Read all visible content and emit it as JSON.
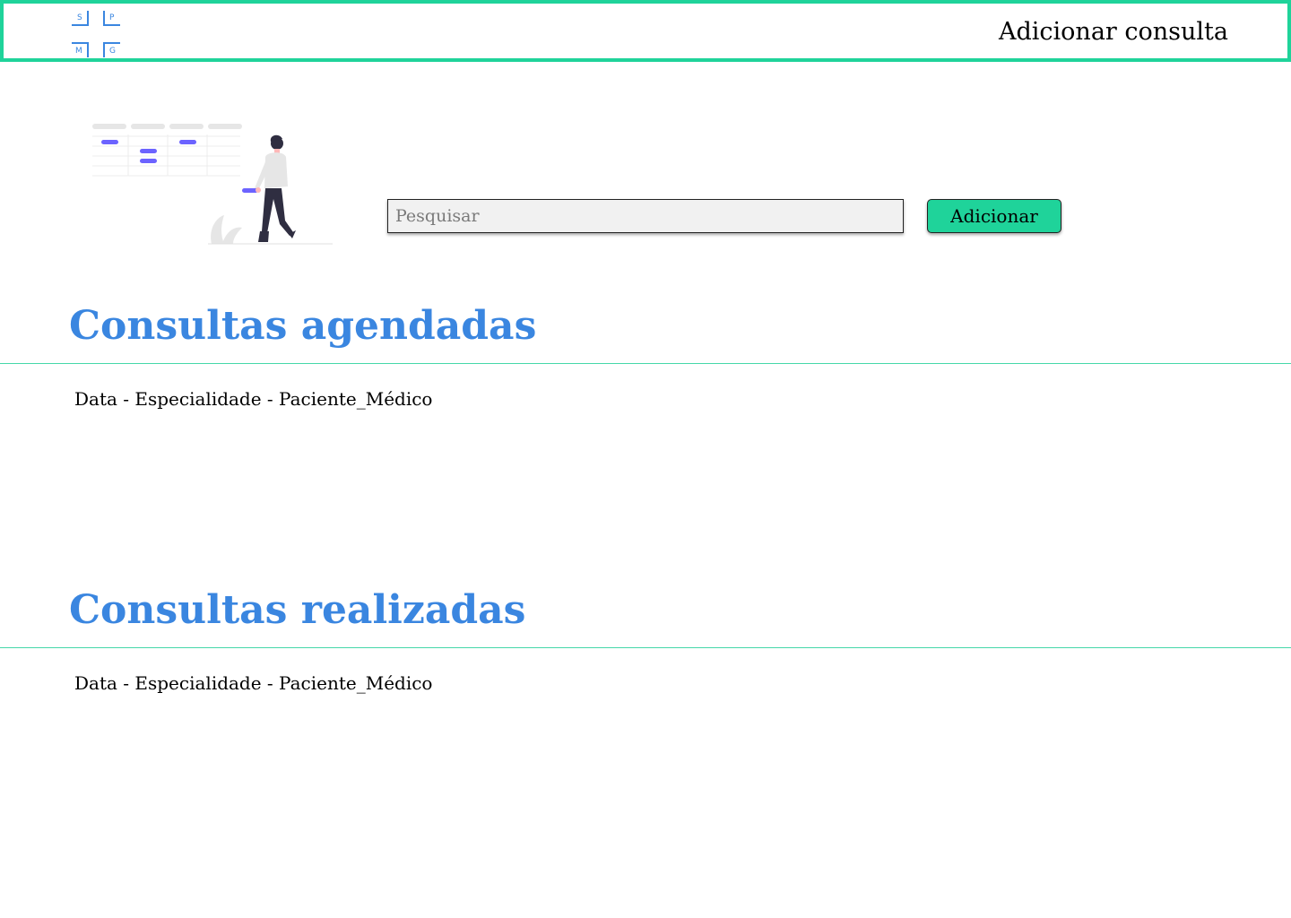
{
  "header": {
    "logo_letters": [
      "S",
      "P",
      "M",
      "G"
    ],
    "nav_link": "Adicionar consulta",
    "border_color": "#1fd39a"
  },
  "search": {
    "placeholder": "Pesquisar",
    "value": ""
  },
  "actions": {
    "add_label": "Adicionar"
  },
  "sections": {
    "scheduled": {
      "title": "Consultas agendadas",
      "items": [
        "Data - Especialidade - Paciente_Médico"
      ]
    },
    "completed": {
      "title": "Consultas realizadas",
      "items": [
        "Data - Especialidade - Paciente_Médico"
      ]
    }
  },
  "colors": {
    "accent": "#1fd39a",
    "title_blue": "#3a86e0",
    "illustration_purple": "#6c63ff"
  },
  "icons": {
    "logo": "spmg-logo-icon",
    "illustration": "calendar-person-illustration"
  }
}
